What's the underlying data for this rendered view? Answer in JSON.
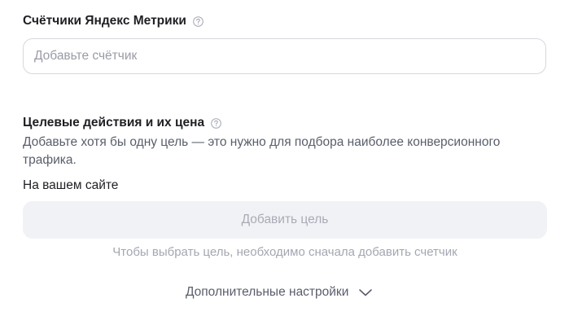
{
  "metrika": {
    "title": "Счётчики Яндекс Метрики",
    "help_icon": "question-circle-icon",
    "input_value": "",
    "input_placeholder": "Добавьте счётчик"
  },
  "goals": {
    "title": "Целевые действия и их цена",
    "help_icon": "question-circle-icon",
    "description": "Добавьте хотя бы одну цель — это нужно для подбора наиболее конверсионного трафика.",
    "site_label": "На вашем сайте",
    "add_goal_button": "Добавить цель",
    "hint": "Чтобы выбрать цель, необходимо сначала добавить счетчик"
  },
  "more_settings": {
    "label": "Дополнительные настройки",
    "icon": "chevron-down-icon"
  },
  "colors": {
    "text_primary": "#1f1f24",
    "text_secondary": "#5a5e6b",
    "text_muted": "#a4a7b1",
    "input_border": "#d6d8de",
    "button_disabled_bg": "#f1f2f6"
  }
}
